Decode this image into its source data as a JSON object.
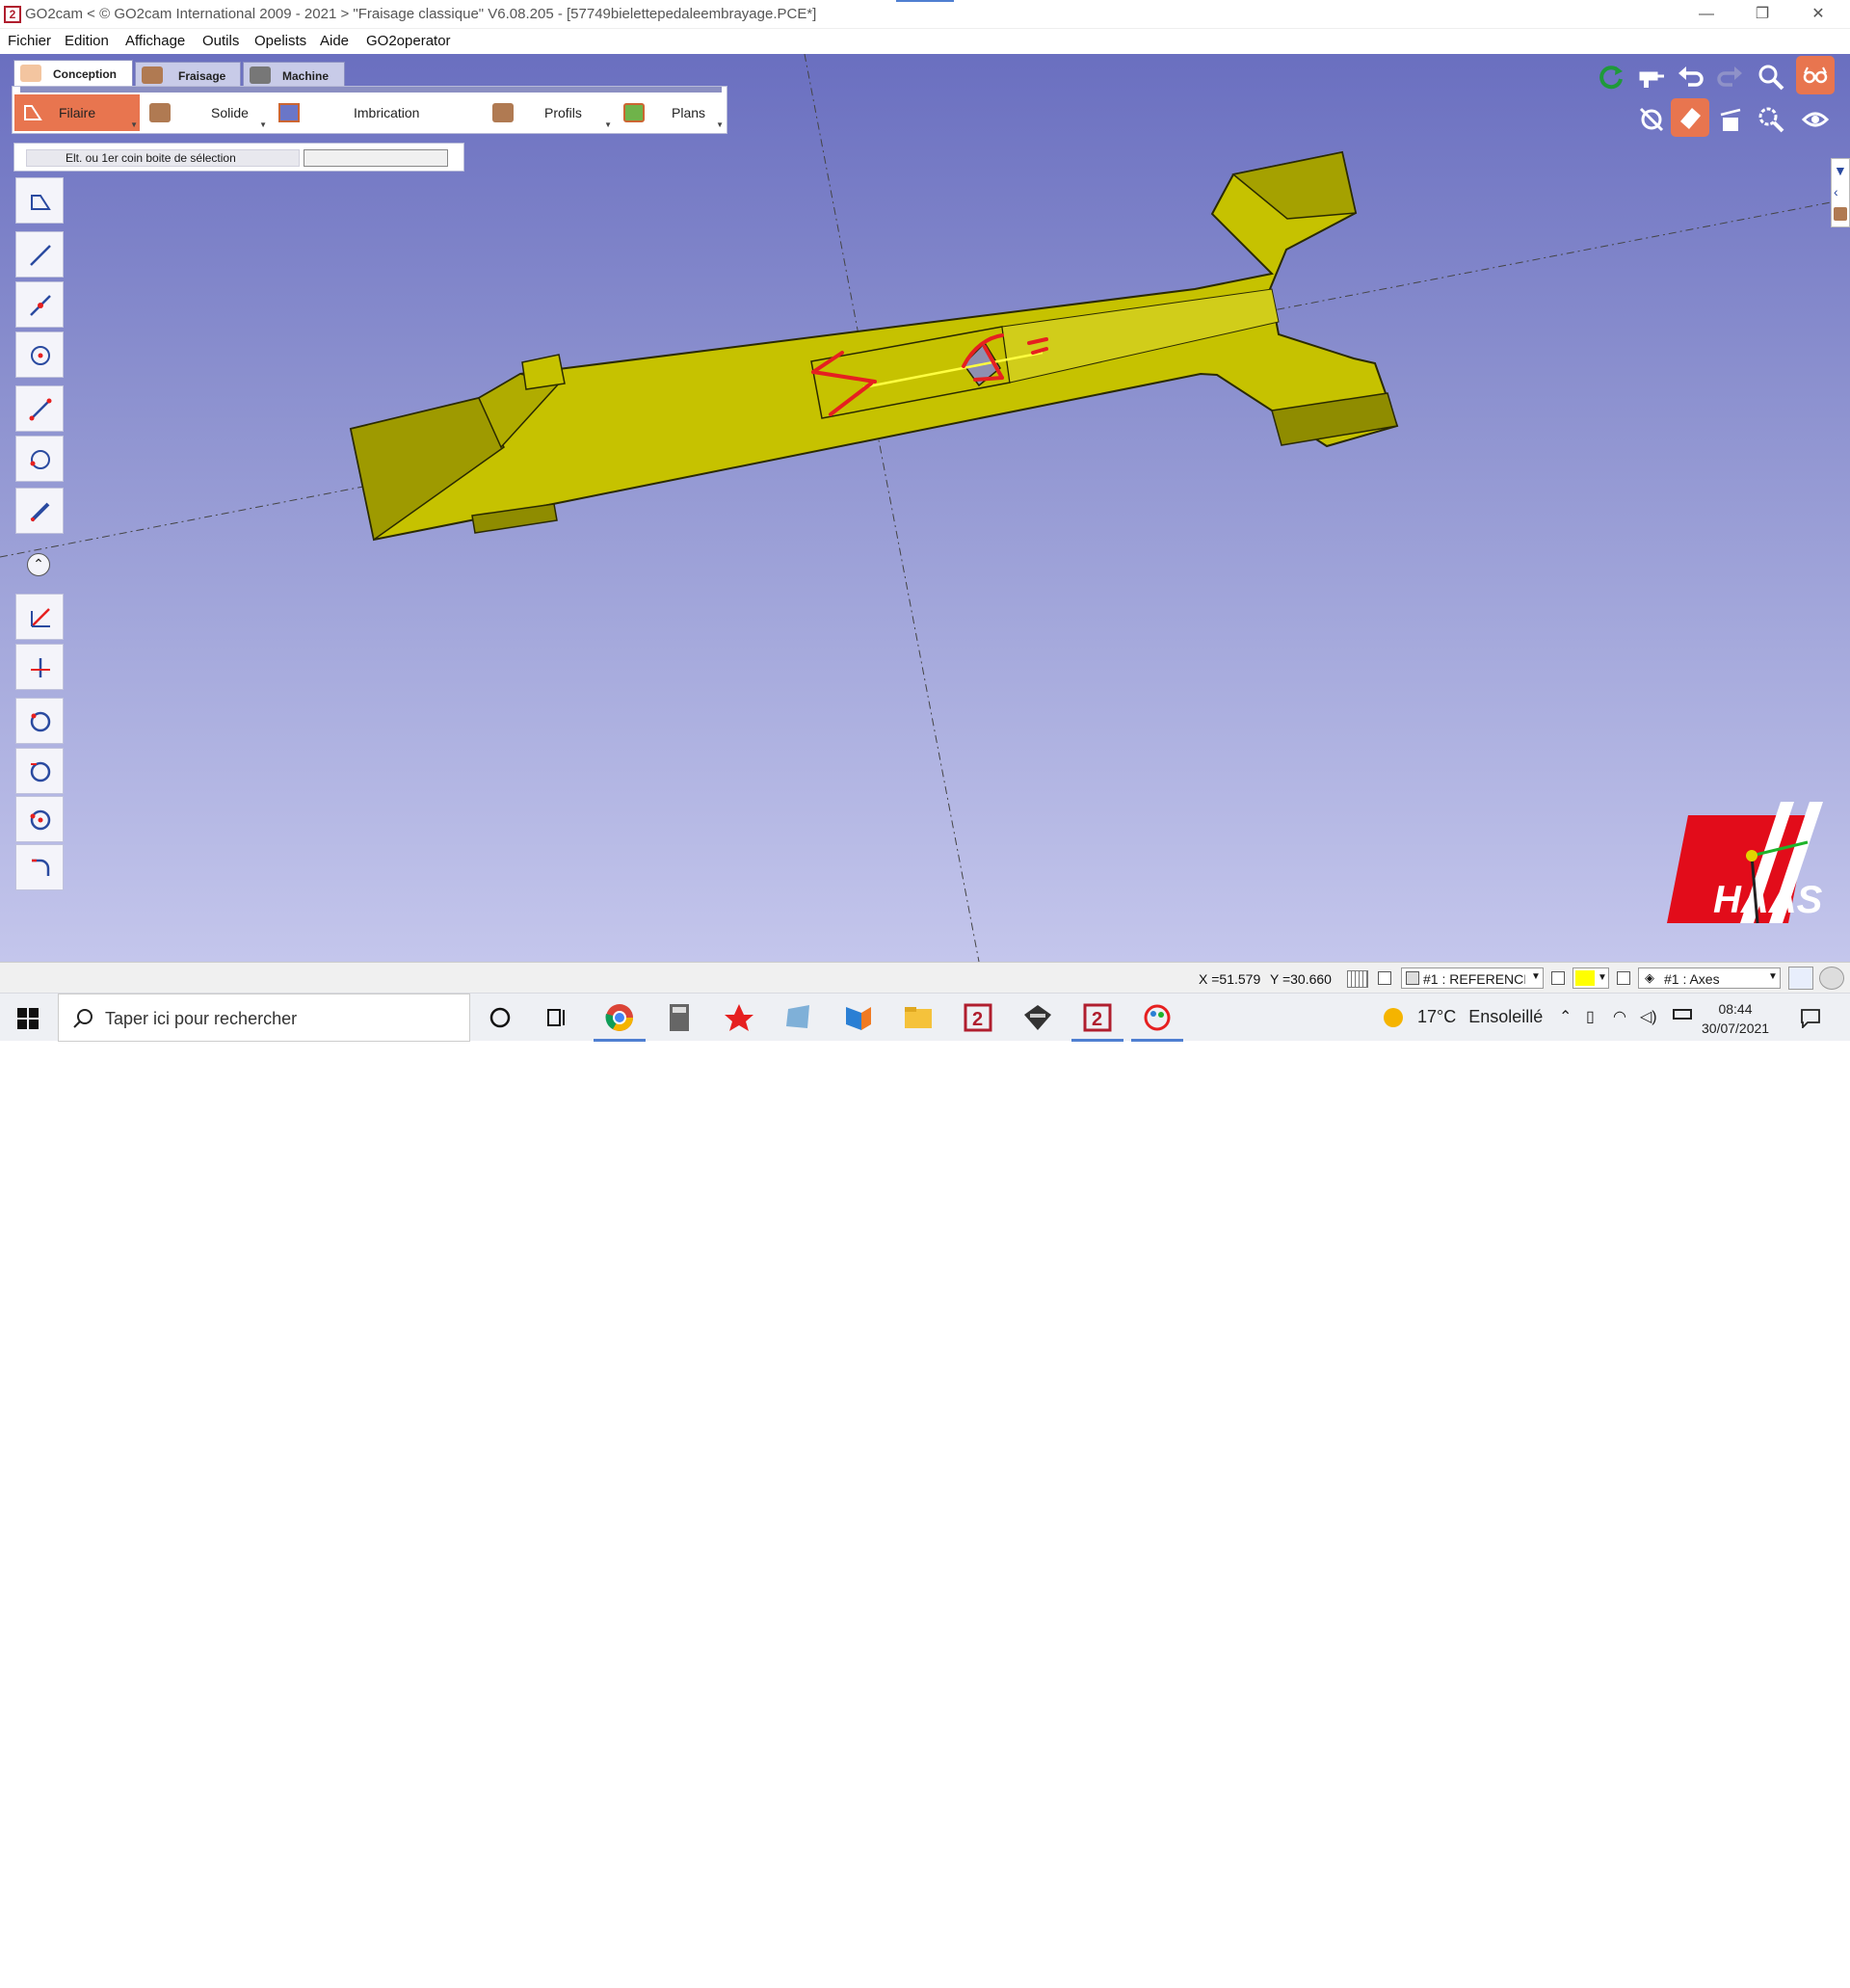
{
  "window": {
    "title": "GO2cam < © GO2cam International 2009 - 2021 >     \"Fraisage classique\"   V6.08.205 - [57749bielettepedaleembrayage.PCE*]",
    "app_icon": "2",
    "controls": {
      "minimize": "—",
      "restore": "❐",
      "close": "✕"
    }
  },
  "menu": [
    "Fichier",
    "Edition",
    "Affichage",
    "Outils",
    "Opelists",
    "Aide",
    "GO2operator"
  ],
  "tabs": [
    {
      "label": "Conception",
      "icon": "conception-icon",
      "active": true
    },
    {
      "label": "Fraisage",
      "icon": "fraisage-icon",
      "active": false
    },
    {
      "label": "Machine",
      "icon": "machine-icon",
      "active": false
    }
  ],
  "ribbon": [
    {
      "label": "Filaire",
      "icon": "wireframe-icon",
      "active": true
    },
    {
      "label": "Solide",
      "icon": "solid-icon",
      "active": false
    },
    {
      "label": "Imbrication",
      "icon": "nesting-icon",
      "active": false
    },
    {
      "label": "Profils",
      "icon": "profiles-icon",
      "active": false
    },
    {
      "label": "Plans",
      "icon": "planes-icon",
      "active": false
    }
  ],
  "prompt": {
    "label": "Elt. ou 1er coin boite de sélection",
    "value": ""
  },
  "left_tools": [
    "polyline-tool-icon",
    "line-tool-icon",
    "line-point-tool-icon",
    "circle-center-tool-icon",
    "segment-tool-icon",
    "arc-tool-icon",
    "pen-tool-icon",
    "collapse-icon",
    "angle-line-tool-icon",
    "perpendicular-tool-icon",
    "circle-3pt-tool-icon",
    "circle-tangent-tool-icon",
    "circle-point-tool-icon",
    "fillet-tool-icon"
  ],
  "right_tools": [
    "regenerate-icon",
    "drill-icon",
    "undo-icon",
    "redo-icon",
    "zoom-icon",
    "glasses-icon",
    "hide-icon",
    "eraser-icon",
    "clean-icon",
    "zoom-window-icon",
    "eye-icon"
  ],
  "status": {
    "x": "X =51.579",
    "y": "Y =30.660",
    "layer": "#1 : REFERENCI",
    "axes": "#1 : Axes",
    "color": "#ffff00"
  },
  "taskbar": {
    "search_placeholder": "Taper ici pour rechercher",
    "weather_temp": "17°C",
    "weather_text": "Ensoleillé",
    "time": "08:44",
    "date": "30/07/2021"
  },
  "colors": {
    "part": "#c6c200",
    "part_dark": "#8f8c00",
    "accent": "#e8754f",
    "brand": "#b01e2e",
    "annotation": "#e62020"
  }
}
